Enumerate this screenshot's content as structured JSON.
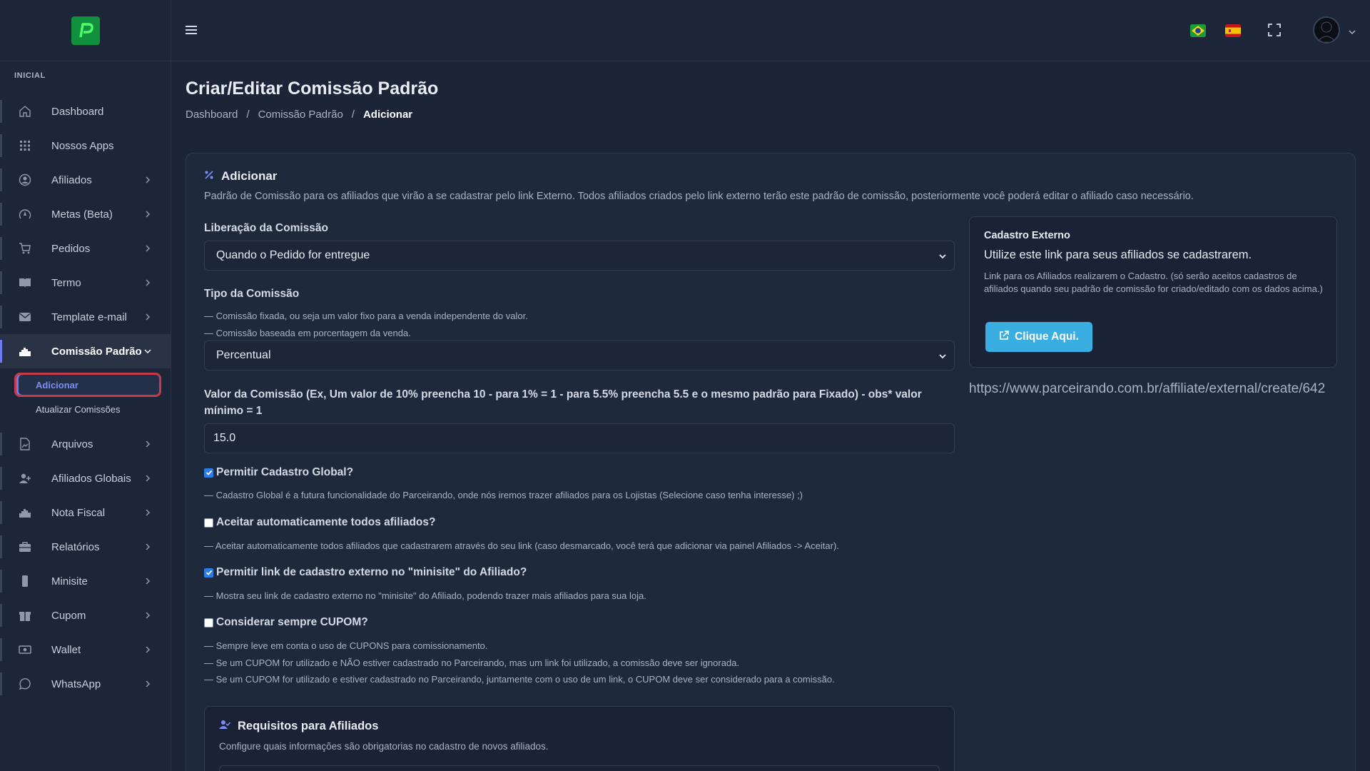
{
  "sidebar": {
    "section_title": "INICIAL",
    "items": [
      {
        "label": "Dashboard",
        "icon": "home-icon"
      },
      {
        "label": "Nossos Apps",
        "icon": "grid-icon"
      },
      {
        "label": "Afiliados",
        "icon": "user-circle-icon"
      },
      {
        "label": "Metas (Beta)",
        "icon": "target-icon"
      },
      {
        "label": "Pedidos",
        "icon": "cart-icon"
      },
      {
        "label": "Termo",
        "icon": "book-icon"
      },
      {
        "label": "Template e-mail",
        "icon": "mail-icon"
      },
      {
        "label": "Comissão Padrão",
        "icon": "chart-icon"
      },
      {
        "label": "Arquivos",
        "icon": "file-icon"
      },
      {
        "label": "Afiliados Globais",
        "icon": "user-plus-icon"
      },
      {
        "label": "Nota Fiscal",
        "icon": "chart-icon"
      },
      {
        "label": "Relatórios",
        "icon": "briefcase-icon"
      },
      {
        "label": "Minisite",
        "icon": "phone-icon"
      },
      {
        "label": "Cupom",
        "icon": "gift-icon"
      },
      {
        "label": "Wallet",
        "icon": "money-icon"
      },
      {
        "label": "WhatsApp",
        "icon": "whatsapp-icon"
      }
    ],
    "submenu": [
      {
        "label": "Adicionar"
      },
      {
        "label": "Atualizar Comissões"
      }
    ]
  },
  "page": {
    "title": "Criar/Editar Comissão Padrão",
    "breadcrumb": [
      "Dashboard",
      "Comissão Padrão",
      "Adicionar"
    ]
  },
  "card": {
    "title": "Adicionar",
    "description": "Padrão de Comissão para os afiliados que virão a se cadastrar pelo link Externo. Todos afiliados criados pelo link externo terão este padrão de comissão, posteriormente você poderá editar o afiliado caso necessário."
  },
  "form": {
    "liberacao_label": "Liberação da Comissão",
    "liberacao_value": "Quando o Pedido for entregue",
    "tipo_label": "Tipo da Comissão",
    "tipo_hint1": "— Comissão fixada, ou seja um valor fixo para a venda independente do valor.",
    "tipo_hint2": "— Comissão baseada em porcentagem da venda.",
    "tipo_value": "Percentual",
    "valor_label": "Valor da Comissão (Ex, Um valor de 10% preencha 10 - para 1% = 1 - para 5.5% preencha 5.5 e o mesmo padrão para Fixado) - obs* valor mínimo = 1",
    "valor_value": "15.0",
    "checks": [
      {
        "label": "Permitir Cadastro Global?",
        "checked": true,
        "hints": [
          "— Cadastro Global é a futura funcionalidade do Parceirando, onde nós iremos trazer afiliados para os Lojistas (Selecione caso tenha interesse) ;)"
        ]
      },
      {
        "label": "Aceitar automaticamente todos afiliados?",
        "checked": false,
        "hints": [
          "— Aceitar automaticamente todos afiliados que cadastrarem através do seu link (caso desmarcado, você terá que adicionar via painel Afiliados -> Aceitar)."
        ]
      },
      {
        "label": "Permitir link de cadastro externo no \"minisite\" do Afiliado?",
        "checked": true,
        "hints": [
          "— Mostra seu link de cadastro externo no \"minisite\" do Afiliado, podendo trazer mais afiliados para sua loja."
        ]
      },
      {
        "label": "Considerar sempre CUPOM?",
        "checked": false,
        "hints": [
          "— Sempre leve em conta o uso de CUPONS para comissionamento.",
          "— Se um CUPOM for utilizado e NÃO estiver cadastrado no Parceirando, mas um link foi utilizado, a comissão deve ser ignorada.",
          "— Se um CUPOM for utilizado e estiver cadastrado no Parceirando, juntamente com o uso de um link, o CUPOM deve ser considerado para a comissão."
        ]
      }
    ]
  },
  "external": {
    "title": "Cadastro Externo",
    "subtitle": "Utilize este link para seus afiliados se cadastrarem.",
    "description": "Link para os Afiliados realizarem o Cadastro. (só serão aceitos cadastros de afiliados quando seu padrão de comissão for criado/editado com os dados acima.)",
    "button_label": "Clique Aqui.",
    "url": "https://www.parceirando.com.br/affiliate/external/create/642"
  },
  "requirements": {
    "title": "Requisitos para Afiliados",
    "description": "Configure quais informações são obrigatorias no cadastro de novos afiliados."
  },
  "colors": {
    "accent": "#6c7cf0",
    "button": "#3aaee0",
    "background": "#1b2537"
  }
}
